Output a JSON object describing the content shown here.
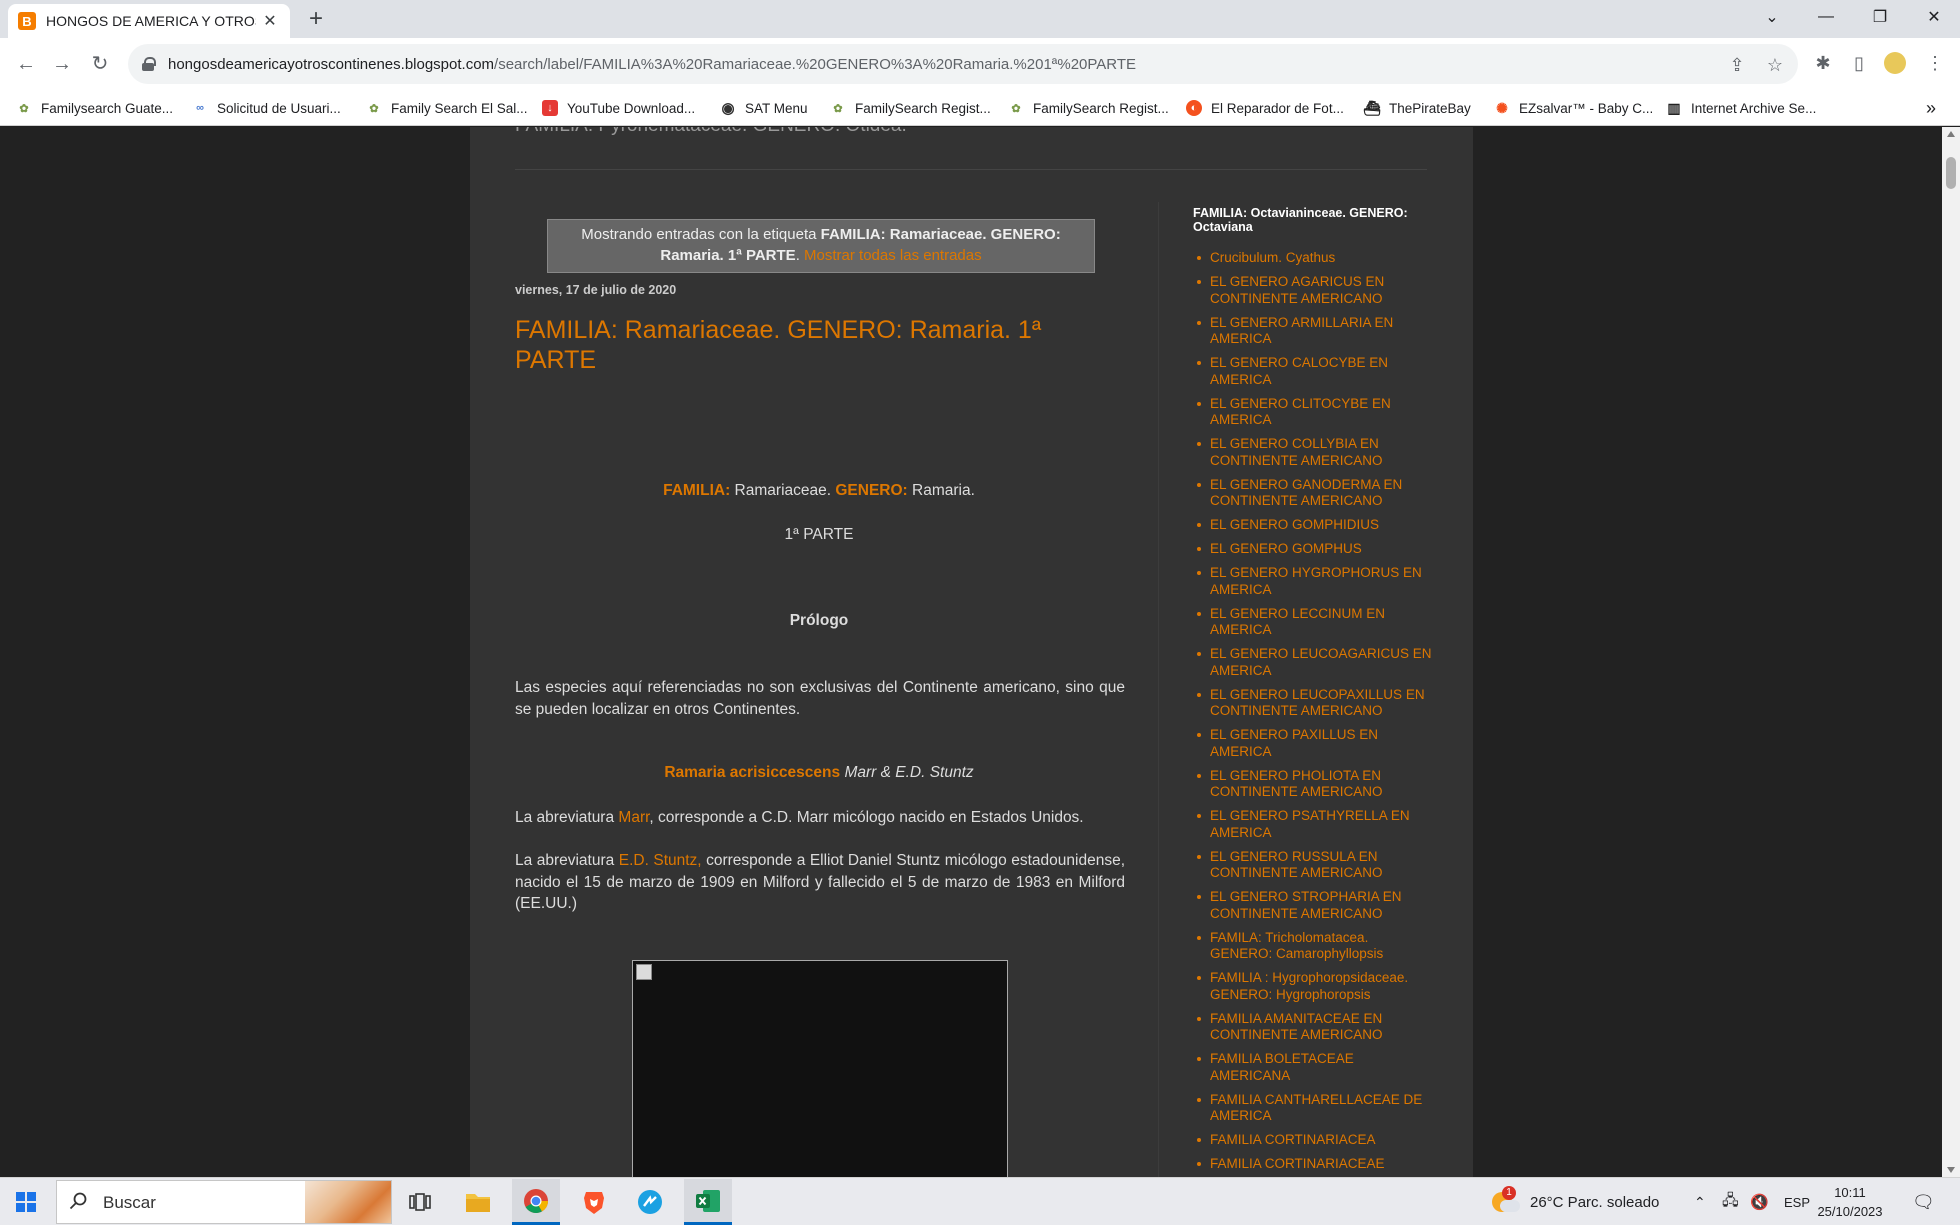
{
  "browser": {
    "tab_title": "HONGOS DE AMERICA Y OTROS CONTINENTES",
    "tab_favicon": "B",
    "url_host": "hongosdeamericayotroscontinenes.blogspot.com",
    "url_path": "/search/label/FAMILIA%3A%20Ramariaceae.%20GENERO%3A%20Ramaria.%201ª%20PARTE",
    "bookmarks": [
      {
        "label": "Familysearch Guate...",
        "icon": "tree-icon"
      },
      {
        "label": "Solicitud de Usuari...",
        "icon": "link-icon"
      },
      {
        "label": "Family Search El Sal...",
        "icon": "tree-icon"
      },
      {
        "label": "YouTube Download...",
        "icon": "download-icon"
      },
      {
        "label": "SAT Menu",
        "icon": "globe-icon"
      },
      {
        "label": "FamilySearch Regist...",
        "icon": "tree-icon"
      },
      {
        "label": "FamilySearch Regist...",
        "icon": "tree-icon"
      },
      {
        "label": "El Reparador de Fot...",
        "icon": "photo-icon"
      },
      {
        "label": "ThePirateBay",
        "icon": "ship-icon"
      },
      {
        "label": "EZsalvar™ - Baby C...",
        "icon": "flame-icon"
      },
      {
        "label": "Internet Archive Se...",
        "icon": "archive-icon"
      }
    ],
    "bookmarks_overflow": "»"
  },
  "page": {
    "top_cut_text": "FAMILIA: Pyronemataceae. GENERO: Otidea.",
    "label_intro": "Mostrando entradas con la etiqueta ",
    "label_name": "FAMILIA: Ramariaceae. GENERO: Ramaria. 1ª PARTE",
    "label_dot": ". ",
    "show_all": "Mostrar todas las entradas",
    "date": "viernes, 17 de julio de 2020",
    "post_title": "FAMILIA: Ramariaceae. GENERO: Ramaria. 1ª PARTE",
    "fam_label": "FAMILIA:",
    "fam_value": " Ramariaceae. ",
    "gen_label": "GENERO:",
    "gen_value": " Ramaria.",
    "part": "1ª PARTE",
    "prologue": "Prólogo",
    "intro": "Las especies aquí referenciadas no son exclusivas del Continente americano, sino que se pueden localizar en otros Continentes.",
    "species_name": "Ramaria acrisiccescens",
    "species_author": " Marr & E.D. Stuntz",
    "abbr1_pre": "La abreviatura ",
    "abbr1_link": "Marr",
    "abbr1_post": ", corresponde a C.D. Marr micólogo nacido en Estados Unidos.",
    "abbr2_pre": "La abreviatura ",
    "abbr2_link": "E.D. Stuntz,",
    "abbr2_post": " corresponde a Elliot Daniel Stuntz micólogo estadounidense, nacido el 15 de marzo de 1909 en Milford y fallecido el 5 de marzo de 1983 en Milford (EE.UU.)"
  },
  "sidebar": {
    "title": "FAMILIA: Octavianinceae. GENERO: Octaviana",
    "items": [
      "Crucibulum. Cyathus",
      "EL GENERO AGARICUS EN CONTINENTE AMERICANO",
      "EL GENERO ARMILLARIA EN AMERICA",
      "EL GENERO CALOCYBE EN AMERICA",
      "EL GENERO CLITOCYBE EN AMERICA",
      "EL GENERO COLLYBIA EN CONTINENTE AMERICANO",
      "EL GENERO GANODERMA EN CONTINENTE AMERICANO",
      "EL GENERO GOMPHIDIUS",
      "EL GENERO GOMPHUS",
      "EL GENERO HYGROPHORUS EN AMERICA",
      "EL GENERO LECCINUM EN AMERICA",
      "EL GENERO LEUCOAGARICUS EN AMERICA",
      "EL GENERO LEUCOPAXILLUS EN CONTINENTE AMERICANO",
      "EL GENERO PAXILLUS EN AMERICA",
      "EL GENERO PHOLIOTA EN CONTINENTE AMERICANO",
      "EL GENERO PSATHYRELLA EN AMERICA",
      "EL GENERO RUSSULA EN CONTINENTE AMERICANO",
      "EL GENERO STROPHARIA EN CONTINENTE AMERICANO",
      "FAMILA: Tricholomatacea. GENERO: Camarophyllopsis",
      "FAMILIA : Hygrophoropsidaceae. GENERO: Hygrophoropsis",
      "FAMILIA AMANITACEAE EN CONTINENTE AMERICANO",
      "FAMILIA BOLETACEAE AMERICANA",
      "FAMILIA CANTHARELLACEAE DE AMERICA",
      "FAMILIA CORTINARIACEA",
      "FAMILIA CORTINARIACEAE"
    ]
  },
  "taskbar": {
    "search_placeholder": "Buscar",
    "weather": "26°C  Parc. soleado",
    "weather_badge": "1",
    "lang": "ESP",
    "time": "10:11",
    "date": "25/10/2023"
  },
  "colors": {
    "accent_orange": "#dd7700",
    "page_bg": "#222222",
    "content_bg": "#333333"
  }
}
